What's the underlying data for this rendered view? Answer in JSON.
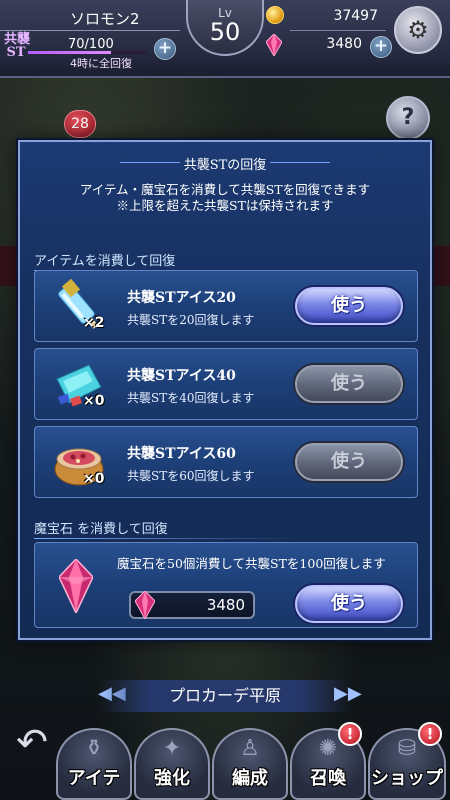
{
  "header": {
    "player_name": "ソロモン2",
    "level_label": "Lv",
    "level": "50",
    "st_label": "共襲\nST",
    "st_value": "70/100",
    "st_fraction": 0.7,
    "st_recover_note": "4時に全回復",
    "gold": "37497",
    "gems": "3480",
    "notification_count": "28",
    "icons": [
      "gold-coin-icon",
      "gem-icon",
      "settings-icon",
      "help-icon",
      "plus-icon"
    ]
  },
  "modal": {
    "title": "共襲STの回復",
    "description_line1": "アイテム・魔宝石を消費して共襲STを回復できます",
    "description_line2": "※上限を超えた共襲STは保持されます",
    "item_section_title": "アイテムを消費して回復",
    "items": [
      {
        "name": "共襲STアイス20",
        "desc": "共襲STを20回復します",
        "count": "×2",
        "button": "使う",
        "enabled": true,
        "icon": "ice-bar-icon"
      },
      {
        "name": "共襲STアイス40",
        "desc": "共襲STを40回復します",
        "count": "×0",
        "button": "使う",
        "enabled": false,
        "icon": "ice-pop-icon"
      },
      {
        "name": "共襲STアイス60",
        "desc": "共襲STを60回復します",
        "count": "×0",
        "button": "使う",
        "enabled": false,
        "icon": "ice-cup-icon"
      }
    ],
    "gem_section_title": "魔宝石 を消費して回復",
    "gem_desc": "魔宝石を50個消費して共襲STを100回復します",
    "gem_balance": "3480",
    "gem_button": "使う"
  },
  "bottom": {
    "area_name": "プロカーデ平原",
    "nav": [
      {
        "label": "アイテ",
        "icon": "potion-icon"
      },
      {
        "label": "強化",
        "icon": "enhance-icon"
      },
      {
        "label": "編成",
        "icon": "party-icon"
      },
      {
        "label": "召喚",
        "icon": "summon-icon",
        "alert": "!"
      },
      {
        "label": "ショップ",
        "icon": "shop-icon",
        "alert": "!"
      }
    ]
  },
  "colors": {
    "modal_bg": "#1c3a73",
    "active_button": "#5a66d8",
    "disabled_button": "#5f6679",
    "st_bar": "#b35cff"
  }
}
